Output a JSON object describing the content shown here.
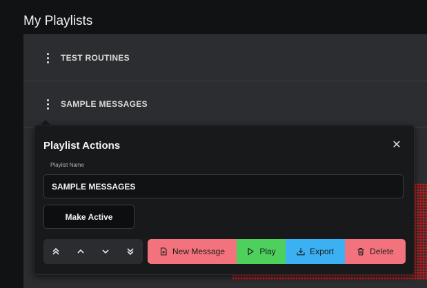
{
  "page": {
    "title": "My Playlists"
  },
  "playlists": [
    {
      "label": "TEST ROUTINES"
    },
    {
      "label": "SAMPLE MESSAGES"
    }
  ],
  "popover": {
    "title": "Playlist Actions",
    "close_symbol": "✕",
    "field_label": "Playlist Name",
    "playlist_name": "SAMPLE MESSAGES",
    "make_active_label": "Make Active",
    "move_buttons": [
      "move-top-icon",
      "move-up-icon",
      "move-down-icon",
      "move-bottom-icon"
    ],
    "actions": {
      "new_message": "New Message",
      "play": "Play",
      "export": "Export",
      "delete": "Delete"
    }
  },
  "colors": {
    "background": "#111214",
    "panel": "#2c2d30",
    "popover": "#18191b",
    "new_message": "#f2737d",
    "play": "#4ed05c",
    "export": "#3bb0f2",
    "delete": "#f2737d",
    "led_dots": "#d11818"
  }
}
